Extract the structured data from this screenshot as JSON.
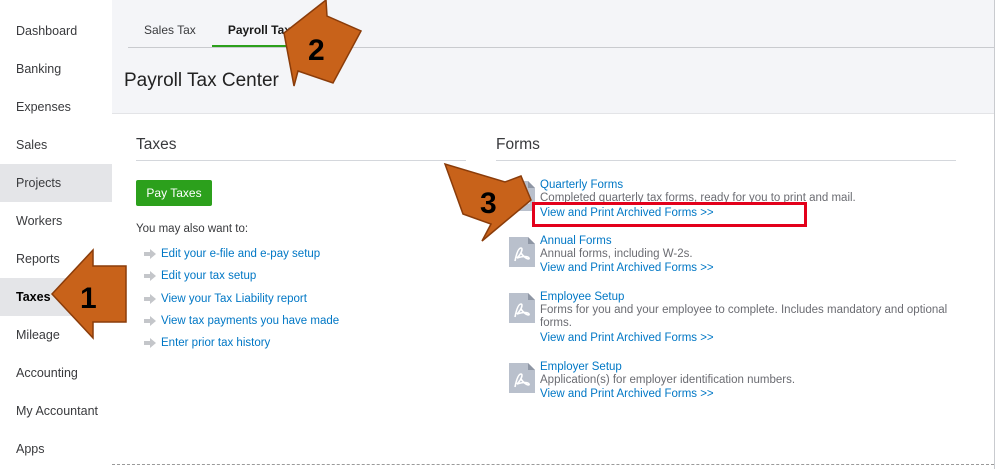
{
  "sidebar": {
    "items": [
      {
        "label": "Dashboard"
      },
      {
        "label": "Banking"
      },
      {
        "label": "Expenses"
      },
      {
        "label": "Sales"
      },
      {
        "label": "Projects"
      },
      {
        "label": "Workers"
      },
      {
        "label": "Reports"
      },
      {
        "label": "Taxes"
      },
      {
        "label": "Mileage"
      },
      {
        "label": "Accounting"
      },
      {
        "label": "My Accountant"
      },
      {
        "label": "Apps"
      }
    ]
  },
  "tabs": [
    {
      "label": "Sales Tax"
    },
    {
      "label": "Payroll Tax",
      "active": true
    }
  ],
  "page_title": "Payroll Tax Center",
  "taxes": {
    "title": "Taxes",
    "pay_button": "Pay Taxes",
    "also_label": "You may also want to:",
    "links": [
      "Edit your e-file and e-pay setup",
      "Edit your tax setup",
      "View your Tax Liability report",
      "View tax payments you have made",
      "Enter prior tax history"
    ]
  },
  "forms": {
    "title": "Forms",
    "items": [
      {
        "title": "Quarterly Forms",
        "desc": "Completed quarterly tax forms, ready for you to print and mail.",
        "link": "View and Print Archived Forms >>"
      },
      {
        "title": "Annual Forms",
        "desc": "Annual forms, including W-2s.",
        "link": "View and Print Archived Forms >>"
      },
      {
        "title": "Employee Setup",
        "desc": "Forms for you and your employee to complete. Includes mandatory and optional forms.",
        "link": "View and Print Archived Forms >>"
      },
      {
        "title": "Employer Setup",
        "desc": "Application(s) for employer identification numbers.",
        "link": "View and Print Archived Forms >>"
      }
    ]
  },
  "annotations": {
    "arrow_1": "1",
    "arrow_2": "2",
    "arrow_3": "3",
    "arrow_color": "#c8621a",
    "highlight_color": "#e3001b"
  },
  "colors": {
    "accent_green": "#2ca01c",
    "link_blue": "#0077c5"
  },
  "icons": {
    "link_bullet": "right-arrow-icon",
    "form": "pdf-document-icon"
  }
}
